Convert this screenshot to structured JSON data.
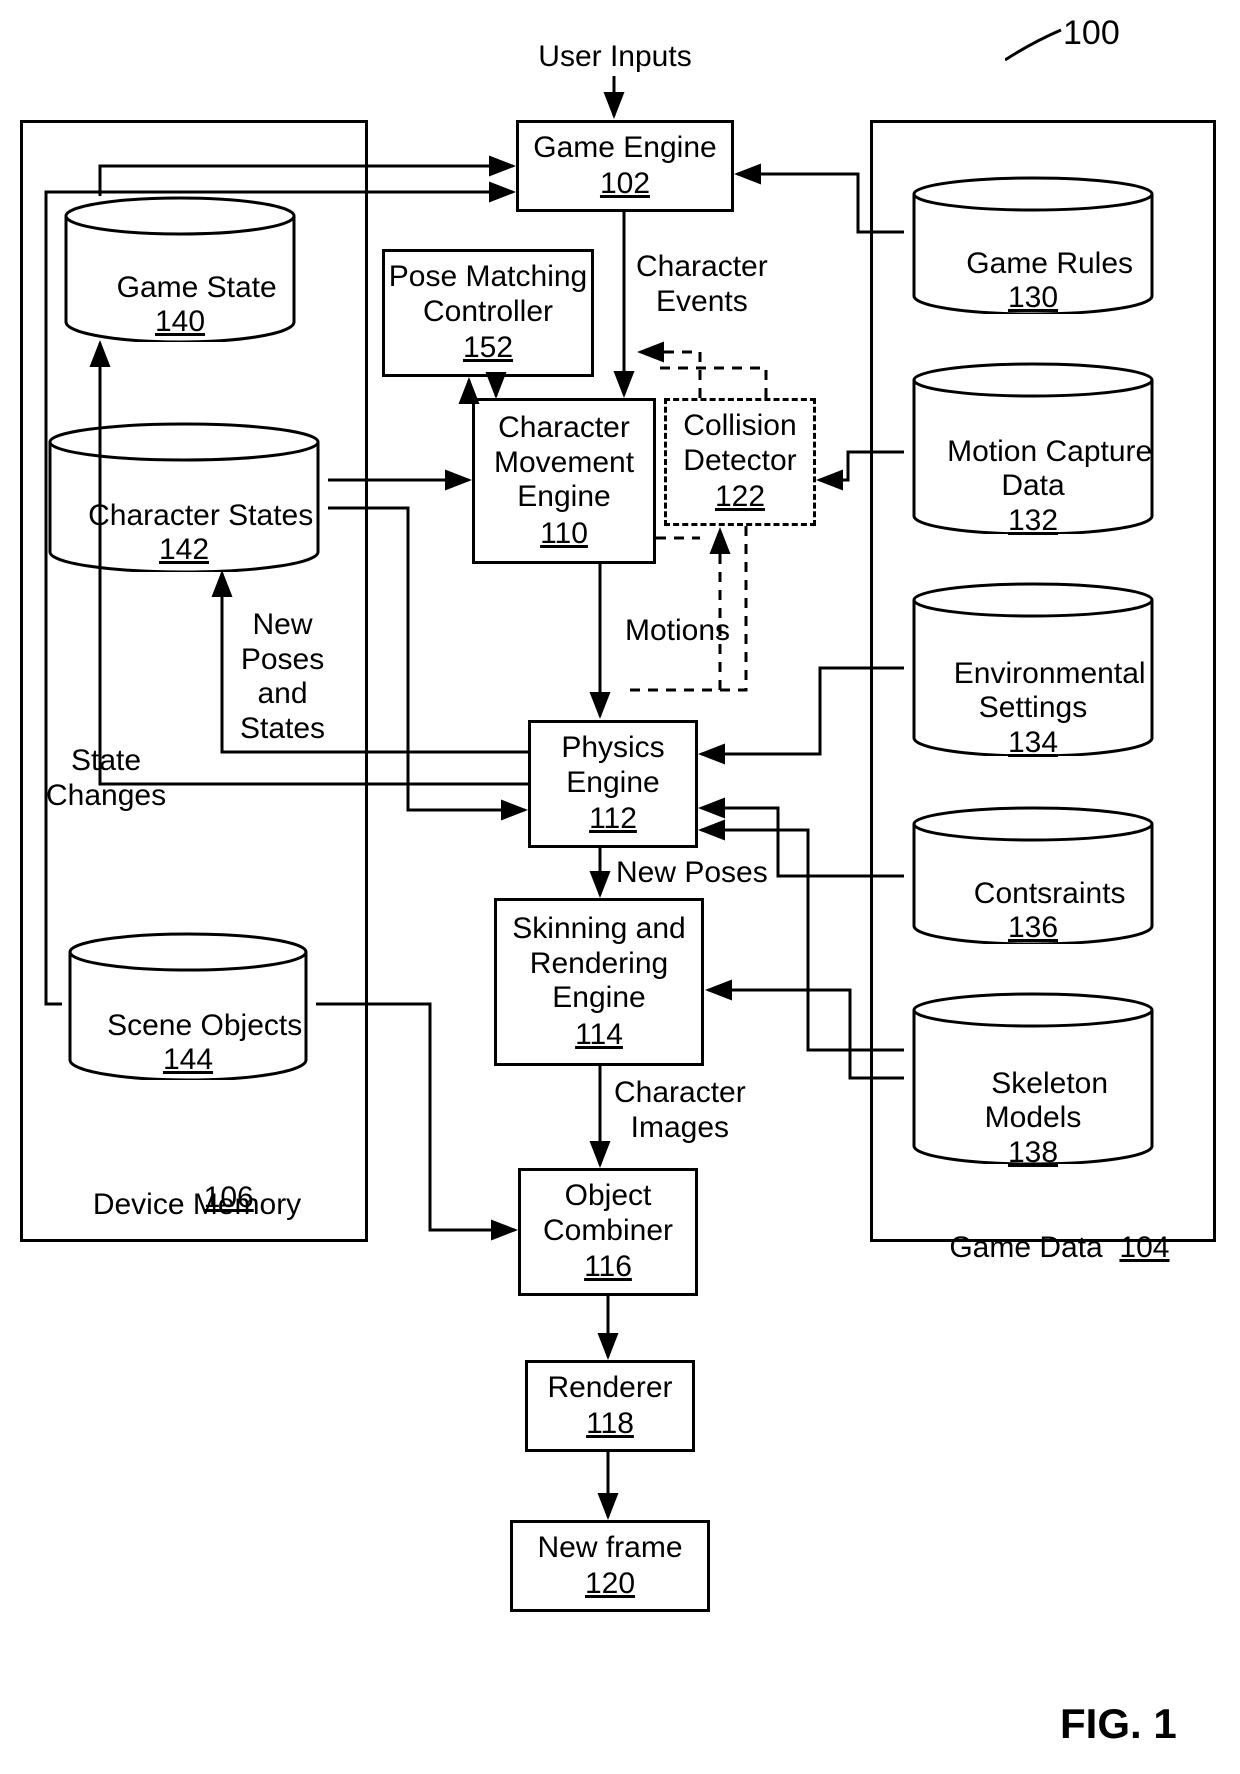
{
  "figure": {
    "ref": "100",
    "title": "FIG. 1"
  },
  "top": {
    "user_inputs": "User Inputs"
  },
  "central": {
    "game_engine": {
      "title": "Game Engine",
      "ref": "102"
    },
    "pose_matching_controller": {
      "title": "Pose Matching\nController",
      "ref": "152"
    },
    "character_events": "Character\nEvents",
    "character_movement_engine": {
      "title": "Character\nMovement\nEngine",
      "ref": "110"
    },
    "collision_detector": {
      "title": "Collision\nDetector",
      "ref": "122"
    },
    "motions": "Motions",
    "physics_engine": {
      "title": "Physics\nEngine",
      "ref": "112"
    },
    "new_poses": "New Poses",
    "skinning_rendering_engine": {
      "title": "Skinning and\nRendering\nEngine",
      "ref": "114"
    },
    "character_images": "Character\nImages",
    "object_combiner": {
      "title": "Object\nCombiner",
      "ref": "116"
    },
    "renderer": {
      "title": "Renderer",
      "ref": "118"
    },
    "new_frame": {
      "title": "New frame",
      "ref": "120"
    }
  },
  "left": {
    "state_changes": "State\nChanges",
    "new_poses_states": "New\nPoses\nand\nStates",
    "container_ref": "106",
    "container_title": "Device Memory",
    "game_state": {
      "title": "Game State",
      "ref": "140"
    },
    "character_states": {
      "title": "Character States",
      "ref": "142"
    },
    "scene_objects": {
      "title": "Scene Objects",
      "ref": "144"
    }
  },
  "right": {
    "container_title": "Game Data",
    "container_ref": "104",
    "game_rules": {
      "title": "Game Rules",
      "ref": "130"
    },
    "motion_capture_data": {
      "title": "Motion Capture\nData",
      "ref": "132"
    },
    "environmental_settings": {
      "title": "Environmental\nSettings",
      "ref": "134"
    },
    "constraints": {
      "title": "Contsraints",
      "ref": "136"
    },
    "skeleton_models": {
      "title": "Skeleton\nModels",
      "ref": "138"
    }
  }
}
